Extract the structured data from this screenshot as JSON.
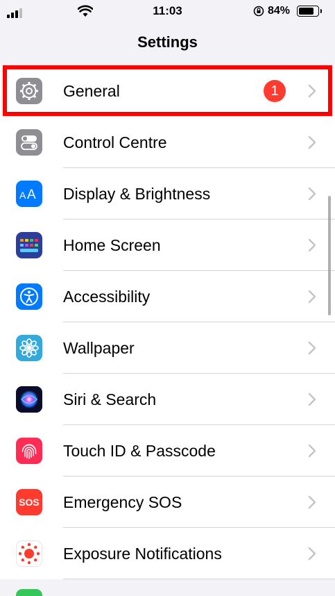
{
  "status_bar": {
    "time": "11:03",
    "battery_percent": "84%",
    "battery_level": 0.84,
    "icons": [
      "cellular-signal-icon",
      "wifi-icon",
      "orientation-lock-icon",
      "battery-icon"
    ]
  },
  "header": {
    "title": "Settings"
  },
  "settings": {
    "items": [
      {
        "label": "General",
        "icon": "gear-icon",
        "color": "#8e8e93",
        "badge": "1",
        "highlighted": true
      },
      {
        "label": "Control Centre",
        "icon": "toggles-icon",
        "color": "#8e8e93"
      },
      {
        "label": "Display & Brightness",
        "icon": "text-size-icon",
        "color": "#007aff"
      },
      {
        "label": "Home Screen",
        "icon": "app-grid-icon",
        "color": "#2c3e99"
      },
      {
        "label": "Accessibility",
        "icon": "accessibility-person-icon",
        "color": "#007aff"
      },
      {
        "label": "Wallpaper",
        "icon": "flower-icon",
        "color": "#34aadc"
      },
      {
        "label": "Siri & Search",
        "icon": "siri-icon",
        "color": "#1c1c3a"
      },
      {
        "label": "Touch ID & Passcode",
        "icon": "fingerprint-icon",
        "color": "#ff2d55"
      },
      {
        "label": "Emergency SOS",
        "icon": "sos-icon",
        "color": "#ff3b30",
        "icon_text": "SOS"
      },
      {
        "label": "Exposure Notifications",
        "icon": "exposure-icon",
        "color": "#ff3b30"
      }
    ]
  },
  "colors": {
    "badge": "#ff3b30",
    "highlight_border": "#ff0000",
    "partial_next_icon": "#34c759"
  }
}
